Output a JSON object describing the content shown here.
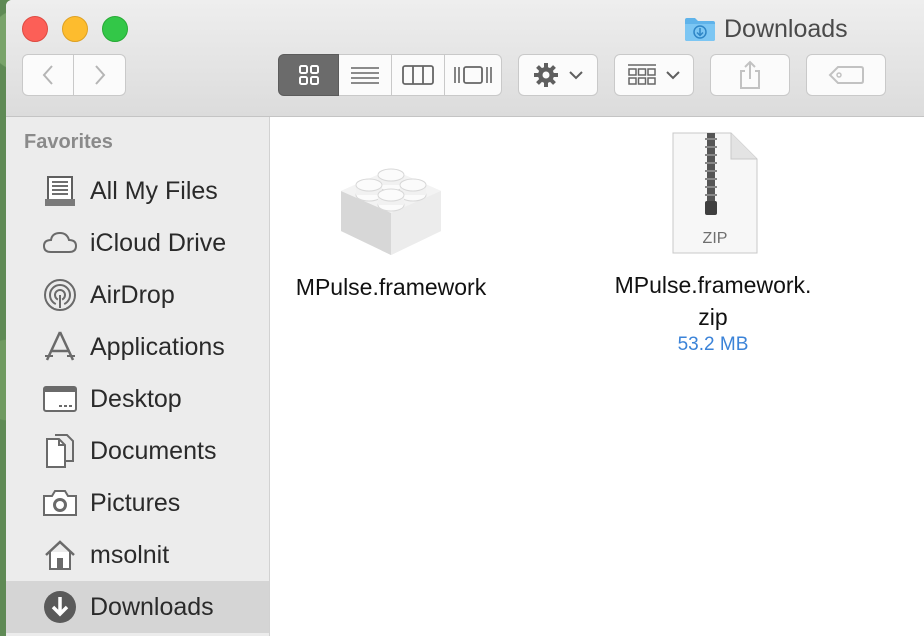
{
  "window": {
    "title": "Downloads",
    "folder_icon": "downloads-folder-icon"
  },
  "toolbar": {
    "back_icon": "chevron-left-icon",
    "forward_icon": "chevron-right-icon",
    "view_modes": [
      "icon-view",
      "list-view",
      "column-view",
      "cover-flow-view"
    ],
    "active_view": "icon-view",
    "action_icon": "gear-icon",
    "arrange_icon": "arrange-grid-icon",
    "share_icon": "share-icon",
    "tag_icon": "tag-icon"
  },
  "sidebar": {
    "heading": "Favorites",
    "items": [
      {
        "label": "All My Files",
        "icon": "all-my-files-icon"
      },
      {
        "label": "iCloud Drive",
        "icon": "cloud-icon"
      },
      {
        "label": "AirDrop",
        "icon": "airdrop-icon"
      },
      {
        "label": "Applications",
        "icon": "applications-icon"
      },
      {
        "label": "Desktop",
        "icon": "desktop-icon"
      },
      {
        "label": "Documents",
        "icon": "documents-icon"
      },
      {
        "label": "Pictures",
        "icon": "camera-icon"
      },
      {
        "label": "msolnit",
        "icon": "home-icon"
      },
      {
        "label": "Downloads",
        "icon": "download-circle-icon",
        "selected": true
      }
    ]
  },
  "files": [
    {
      "name": "MPulse.framework",
      "icon": "framework-lego-icon"
    },
    {
      "name_line1": "MPulse.framework.",
      "name_line2": "zip",
      "size": "53.2 MB",
      "icon": "zip-file-icon",
      "badge": "ZIP"
    }
  ],
  "colors": {
    "accent_blue": "#3b83d8",
    "selected_row": "#d5d5d5"
  }
}
